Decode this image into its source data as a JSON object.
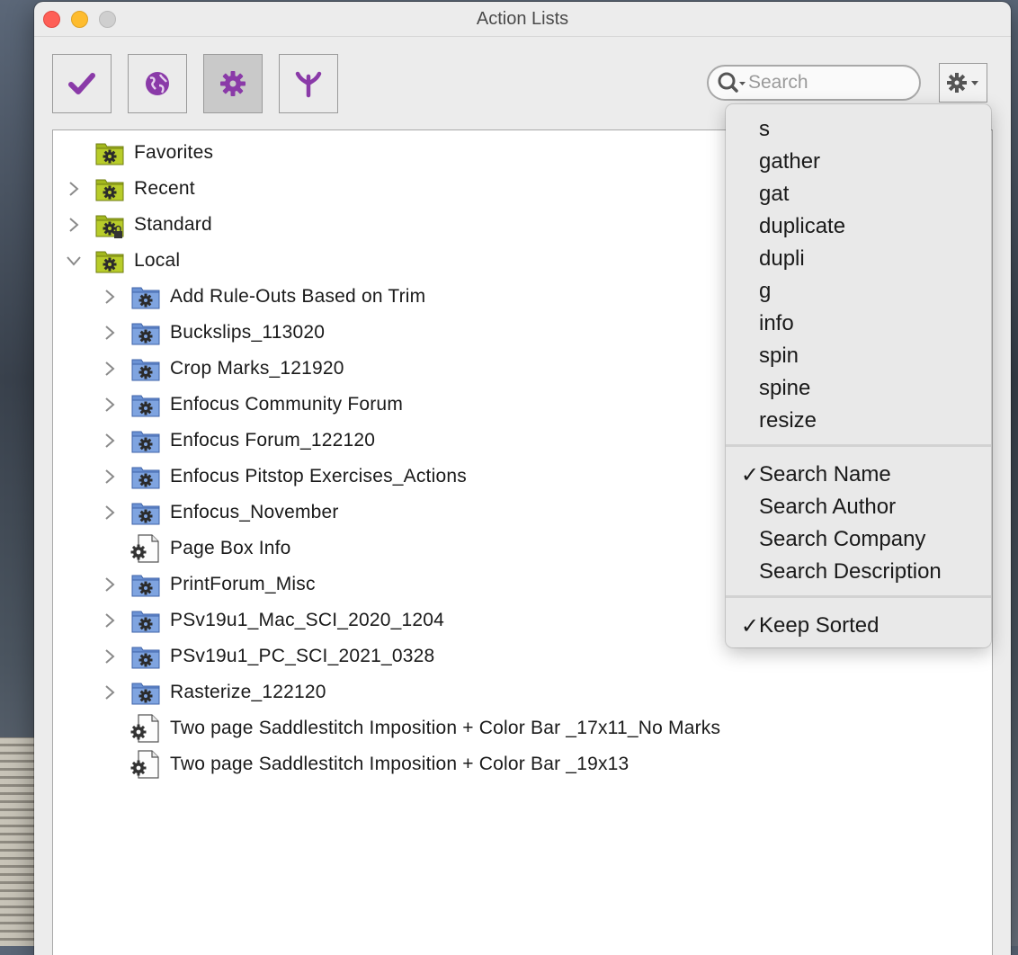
{
  "window": {
    "title": "Action Lists"
  },
  "toolbar": {
    "buttons": [
      {
        "name": "checkmark",
        "icon": "checkmark-icon",
        "color": "#8a3aa8",
        "active": false
      },
      {
        "name": "globe",
        "icon": "globe-icon",
        "color": "#8a3aa8",
        "active": false
      },
      {
        "name": "gear",
        "icon": "gear-icon",
        "color": "#8a3aa8",
        "active": true
      },
      {
        "name": "branch",
        "icon": "branch-icon",
        "color": "#8a3aa8",
        "active": false
      }
    ]
  },
  "search": {
    "placeholder": "Search",
    "value": ""
  },
  "tree": {
    "items": [
      {
        "label": "Favorites",
        "type": "folder-yellow",
        "disclosure": "none"
      },
      {
        "label": "Recent",
        "type": "folder-yellow",
        "disclosure": "collapsed"
      },
      {
        "label": "Standard",
        "type": "folder-yellow-locked",
        "disclosure": "collapsed"
      },
      {
        "label": "Local",
        "type": "folder-yellow",
        "disclosure": "expanded"
      },
      {
        "label": "Add Rule-Outs Based on Trim",
        "type": "folder-blue",
        "disclosure": "collapsed"
      },
      {
        "label": "Buckslips_113020",
        "type": "folder-blue",
        "disclosure": "collapsed"
      },
      {
        "label": "Crop Marks_121920",
        "type": "folder-blue",
        "disclosure": "collapsed"
      },
      {
        "label": "Enfocus Community Forum",
        "type": "folder-blue",
        "disclosure": "collapsed"
      },
      {
        "label": "Enfocus Forum_122120",
        "type": "folder-blue",
        "disclosure": "collapsed"
      },
      {
        "label": "Enfocus Pitstop Exercises_Actions",
        "type": "folder-blue",
        "disclosure": "collapsed"
      },
      {
        "label": "Enfocus_November",
        "type": "folder-blue",
        "disclosure": "collapsed"
      },
      {
        "label": "Page Box Info",
        "type": "document",
        "disclosure": "none"
      },
      {
        "label": "PrintForum_Misc",
        "type": "folder-blue",
        "disclosure": "collapsed"
      },
      {
        "label": "PSv19u1_Mac_SCI_2020_1204",
        "type": "folder-blue",
        "disclosure": "collapsed"
      },
      {
        "label": "PSv19u1_PC_SCI_2021_0328",
        "type": "folder-blue",
        "disclosure": "collapsed"
      },
      {
        "label": "Rasterize_122120",
        "type": "folder-blue",
        "disclosure": "collapsed"
      },
      {
        "label": "Two page Saddlestitch Imposition + Color Bar _17x11_No Marks",
        "type": "document",
        "disclosure": "none"
      },
      {
        "label": "Two page Saddlestitch Imposition + Color Bar _19x13",
        "type": "document",
        "disclosure": "none"
      }
    ]
  },
  "menu": {
    "recent_searches": [
      "s",
      "gather",
      "gat",
      "duplicate",
      "dupli",
      "g",
      "info",
      "spin",
      "spine",
      "resize"
    ],
    "search_options": [
      {
        "label": "Search Name",
        "checked": true
      },
      {
        "label": "Search Author",
        "checked": false
      },
      {
        "label": "Search Company",
        "checked": false
      },
      {
        "label": "Search Description",
        "checked": false
      }
    ],
    "sort_options": [
      {
        "label": "Keep Sorted",
        "checked": true
      }
    ],
    "check_glyph": "✓"
  }
}
